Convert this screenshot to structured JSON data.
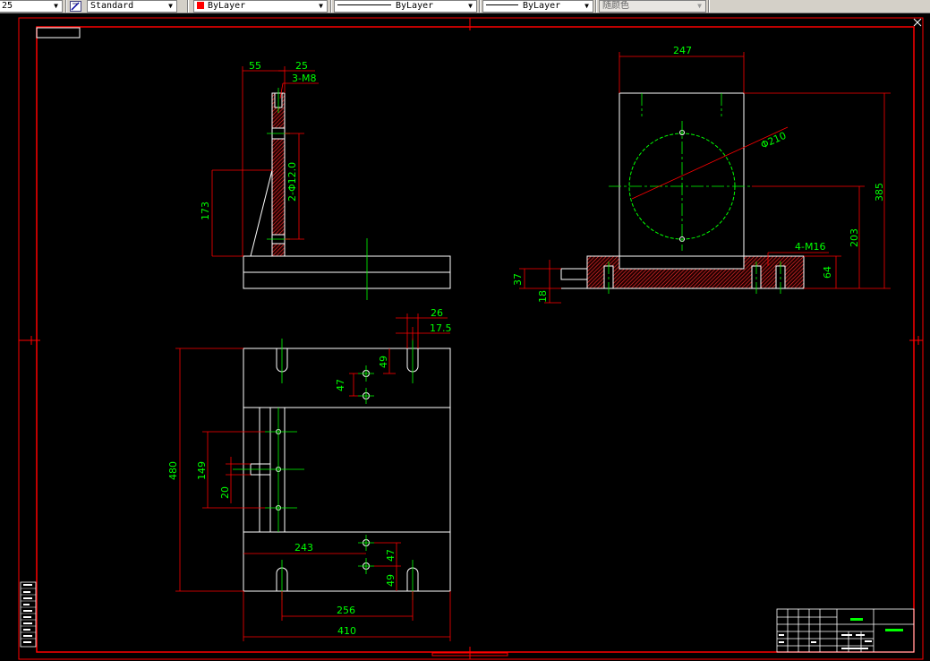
{
  "toolbar": {
    "dimstyle_value": "25",
    "textstyle_value": "Standard",
    "layer_value": "ByLayer",
    "linetype_value": "ByLayer",
    "lineweight_value": "ByLayer",
    "plotstyle_value": "随颜色"
  },
  "colors": {
    "background": "#000000",
    "frame": "#ff0000",
    "geometry": "#ffffff",
    "dimension_text": "#00ff00",
    "centerline": "#00ff00",
    "hatch": "#ff3030",
    "toolbar_bg": "#d4d0c8",
    "layer_swatch": "#ff0000"
  },
  "side_view": {
    "dims": {
      "w55": "55",
      "w25": "25",
      "thread": "3-M8",
      "holes": "2-Φ12.0",
      "height": "173"
    }
  },
  "front_view": {
    "dims": {
      "width": "247",
      "bore": "Φ210",
      "height": "385",
      "center": "203",
      "thread": "4-M16",
      "base": "64",
      "left_h": "37",
      "left_b": "18"
    }
  },
  "top_view": {
    "dims": {
      "slot_w": "26",
      "slot_c": "17.5",
      "d49a": "49",
      "d47a": "47",
      "length": "480",
      "d149": "149",
      "d20": "20",
      "d243": "243",
      "d47b": "47",
      "d49b": "49",
      "d256": "256",
      "d410": "410"
    }
  }
}
